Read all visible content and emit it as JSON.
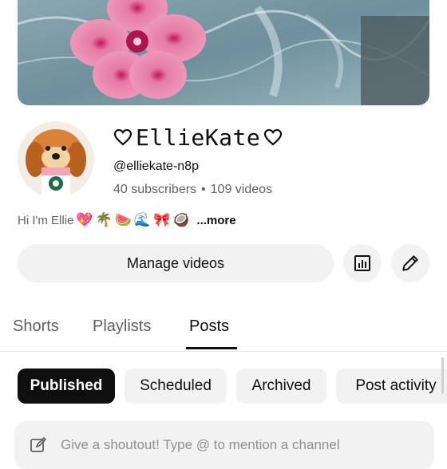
{
  "channel": {
    "name": "EllieKate",
    "handle": "@elliekate-n8p",
    "subscribers": "40 subscribers",
    "separator": "•",
    "videos": "109 videos",
    "bio_text": "Hi I'm Ellie",
    "bio_emojis": [
      "💖",
      "🌴",
      "🍉",
      "🌊",
      "🎀",
      "🥥"
    ],
    "more_label": "...more"
  },
  "actions": {
    "manage_label": "Manage videos",
    "analytics_icon": "analytics-icon",
    "edit_icon": "pencil-icon"
  },
  "tabs": [
    {
      "label": "Shorts",
      "active": false
    },
    {
      "label": "Playlists",
      "active": false
    },
    {
      "label": "Posts",
      "active": true
    }
  ],
  "chips": [
    {
      "label": "Published",
      "selected": true
    },
    {
      "label": "Scheduled",
      "selected": false
    },
    {
      "label": "Archived",
      "selected": false
    },
    {
      "label": "Post activity",
      "selected": false
    }
  ],
  "composer": {
    "placeholder": "Give a shoutout! Type @ to mention a channel"
  },
  "colors": {
    "text_primary": "#0f0f0f",
    "text_secondary": "#606060",
    "chip_bg": "#f2f2f2",
    "chip_selected_bg": "#0f0f0f",
    "bio_emoji_heart": "#e94d8a"
  }
}
